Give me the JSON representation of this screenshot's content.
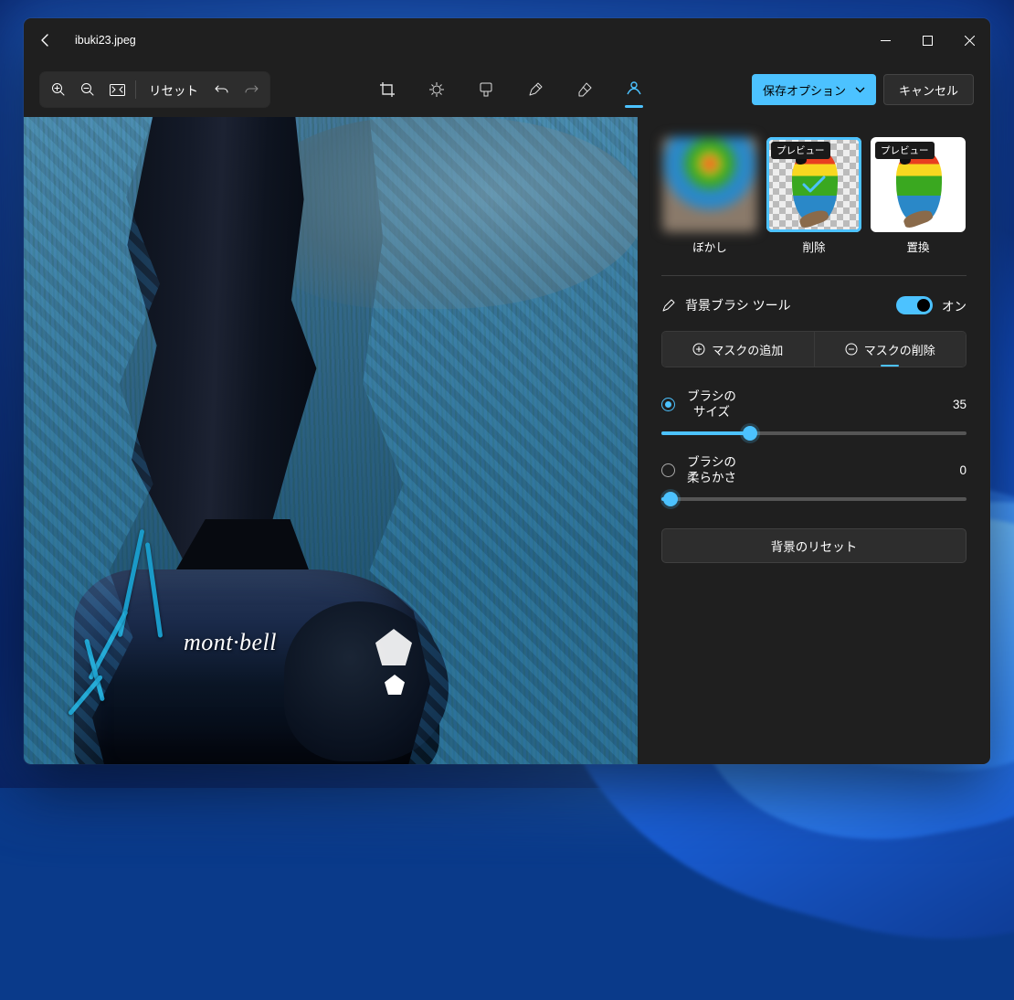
{
  "filename": "ibuki23.jpeg",
  "toolbar": {
    "reset": "リセット"
  },
  "actions": {
    "save": "保存オプション",
    "cancel": "キャンセル"
  },
  "panel": {
    "thumbs": [
      {
        "label": "ぼかし",
        "badge": null
      },
      {
        "label": "削除",
        "badge": "プレビュー"
      },
      {
        "label": "置換",
        "badge": "プレビュー"
      }
    ],
    "brush_tool": "背景ブラシ ツール",
    "toggle_state": "オン",
    "seg": {
      "add": "マスクの追加",
      "remove": "マスクの削除"
    },
    "brush_size": {
      "label": "ブラシのサイズ",
      "value": "35",
      "pct": 29
    },
    "brush_soft": {
      "label": "ブラシの柔らかさ",
      "value": "0",
      "pct": 3
    },
    "reset_bg": "背景のリセット"
  },
  "shoe_brand": "mont·bell"
}
